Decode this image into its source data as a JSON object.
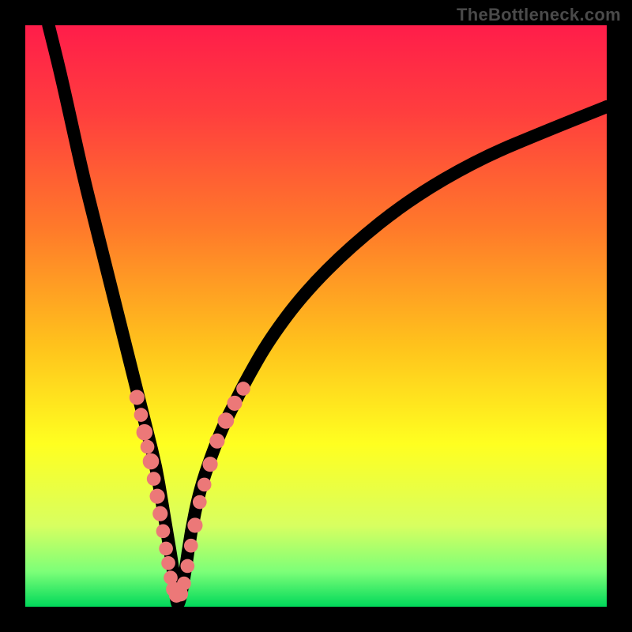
{
  "watermark": "TheBottleneck.com",
  "colors": {
    "gradient_stops": [
      {
        "pct": 0,
        "color": "#ff1d4a"
      },
      {
        "pct": 15,
        "color": "#ff3e3e"
      },
      {
        "pct": 35,
        "color": "#ff7a2a"
      },
      {
        "pct": 55,
        "color": "#ffc21c"
      },
      {
        "pct": 72,
        "color": "#ffff20"
      },
      {
        "pct": 86,
        "color": "#d8ff60"
      },
      {
        "pct": 94,
        "color": "#7cff78"
      },
      {
        "pct": 100,
        "color": "#00d85a"
      }
    ],
    "curve": "#000000",
    "dot_fill": "#ec7878"
  },
  "chart_data": {
    "type": "line",
    "title": "",
    "xlabel": "",
    "ylabel": "",
    "x_range": [
      0,
      100
    ],
    "y_range": [
      0,
      100
    ],
    "notch_x": 26,
    "series": [
      {
        "name": "bottleneck-curve",
        "x": [
          4,
          6,
          8,
          10,
          12,
          14,
          16,
          18,
          19.5,
          21,
          22.5,
          23.5,
          24.5,
          25.5,
          26,
          26.5,
          27.5,
          28.5,
          30,
          32,
          34,
          36,
          38,
          42,
          48,
          56,
          66,
          78,
          90,
          100
        ],
        "y": [
          100,
          92,
          83,
          74,
          66,
          58,
          50,
          42,
          36,
          30,
          24,
          18,
          12,
          6,
          0.5,
          0.5,
          6,
          13,
          20,
          26,
          31,
          35,
          39,
          46,
          54,
          62,
          70,
          77,
          82,
          86
        ]
      }
    ],
    "scatter": {
      "name": "highlighted-points",
      "points": [
        {
          "x": 19.2,
          "y": 36.0,
          "r": 1.3
        },
        {
          "x": 19.9,
          "y": 33.0,
          "r": 1.2
        },
        {
          "x": 20.5,
          "y": 30.0,
          "r": 1.4
        },
        {
          "x": 21.0,
          "y": 27.5,
          "r": 1.2
        },
        {
          "x": 21.6,
          "y": 25.0,
          "r": 1.4
        },
        {
          "x": 22.1,
          "y": 22.0,
          "r": 1.2
        },
        {
          "x": 22.7,
          "y": 19.0,
          "r": 1.3
        },
        {
          "x": 23.2,
          "y": 16.0,
          "r": 1.3
        },
        {
          "x": 23.7,
          "y": 13.0,
          "r": 1.2
        },
        {
          "x": 24.2,
          "y": 10.0,
          "r": 1.2
        },
        {
          "x": 24.6,
          "y": 7.5,
          "r": 1.2
        },
        {
          "x": 25.0,
          "y": 5.0,
          "r": 1.2
        },
        {
          "x": 25.5,
          "y": 3.0,
          "r": 1.3
        },
        {
          "x": 26.0,
          "y": 2.0,
          "r": 1.3
        },
        {
          "x": 26.7,
          "y": 2.2,
          "r": 1.3
        },
        {
          "x": 27.3,
          "y": 4.0,
          "r": 1.2
        },
        {
          "x": 27.9,
          "y": 7.0,
          "r": 1.2
        },
        {
          "x": 28.5,
          "y": 10.5,
          "r": 1.2
        },
        {
          "x": 29.2,
          "y": 14.0,
          "r": 1.3
        },
        {
          "x": 30.0,
          "y": 18.0,
          "r": 1.2
        },
        {
          "x": 30.8,
          "y": 21.0,
          "r": 1.2
        },
        {
          "x": 31.8,
          "y": 24.5,
          "r": 1.3
        },
        {
          "x": 33.0,
          "y": 28.5,
          "r": 1.3
        },
        {
          "x": 34.5,
          "y": 32.0,
          "r": 1.4
        },
        {
          "x": 36.0,
          "y": 35.0,
          "r": 1.3
        },
        {
          "x": 37.5,
          "y": 37.5,
          "r": 1.2
        }
      ]
    }
  }
}
